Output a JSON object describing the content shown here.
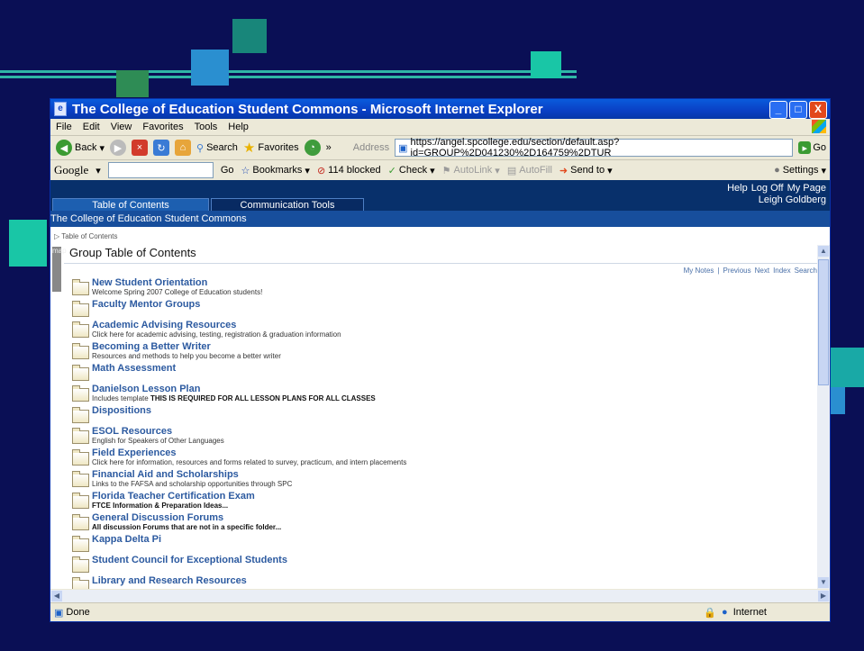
{
  "window": {
    "title": "The College of Education Student Commons - Microsoft Internet Explorer",
    "buttons": [
      "_",
      "□",
      "X"
    ]
  },
  "menu": [
    "File",
    "Edit",
    "View",
    "Favorites",
    "Tools",
    "Help"
  ],
  "toolbar": {
    "back": "Back",
    "search": "Search",
    "favorites": "Favorites",
    "address_label": "Address",
    "address": "https://angel.spcollege.edu/section/default.asp?id=GROUP%2D041230%2D164759%2DTUR",
    "go": "Go"
  },
  "google_bar": {
    "logo": "Google",
    "go": "Go",
    "bookmarks": "Bookmarks",
    "blocked": "114 blocked",
    "check": "Check",
    "autolink": "AutoLink",
    "autofill": "AutoFill",
    "send_to": "Send to",
    "settings": "Settings"
  },
  "angel": {
    "top_links": [
      "Help",
      "Log Off",
      "My Page"
    ],
    "user": "Leigh Goldberg",
    "tabs": [
      "Table of Contents",
      "Communication Tools"
    ],
    "course_title": "The College of Education Student Commons",
    "breadcrumb": "▷ Table of Contents",
    "map_tab": "map",
    "heading": "Group Table of Contents",
    "links": [
      "My Notes",
      "|",
      "Previous",
      "Next",
      "Index",
      "Search"
    ]
  },
  "toc_items": [
    {
      "title": "New Student Orientation",
      "desc": "Welcome Spring 2007 College of Education students!"
    },
    {
      "title": "Faculty Mentor Groups",
      "desc": ""
    },
    {
      "title": "Academic Advising Resources",
      "desc": "Click here for academic advising, testing, registration & graduation information"
    },
    {
      "title": "Becoming a Better Writer",
      "desc": "Resources and methods to help you become a better writer"
    },
    {
      "title": "Math Assessment",
      "desc": ""
    },
    {
      "title": "Danielson Lesson Plan",
      "desc": "Includes template ",
      "desc_bold": "THIS IS REQUIRED FOR ALL LESSON PLANS FOR ALL CLASSES"
    },
    {
      "title": "Dispositions",
      "desc": ""
    },
    {
      "title": "ESOL Resources",
      "desc": "English for Speakers of Other Languages"
    },
    {
      "title": "Field Experiences",
      "desc": "Click here for information, resources and forms related to survey, practicum, and intern placements"
    },
    {
      "title": "Financial Aid and Scholarships",
      "desc": "Links to the FAFSA and scholarship opportunities through SPC"
    },
    {
      "title": "Florida Teacher Certification Exam",
      "desc": "",
      "desc_bold": "FTCE Information & Preparation Ideas..."
    },
    {
      "title": "General Discussion Forums",
      "desc": "",
      "desc_bold": "All discussion Forums that are not in a specific folder..."
    },
    {
      "title": "Kappa Delta Pi",
      "desc": ""
    },
    {
      "title": "Student Council for Exceptional Students",
      "desc": ""
    },
    {
      "title": "Library and Research Resources",
      "desc": ""
    }
  ],
  "status": {
    "left": "Done",
    "zone": "Internet"
  }
}
